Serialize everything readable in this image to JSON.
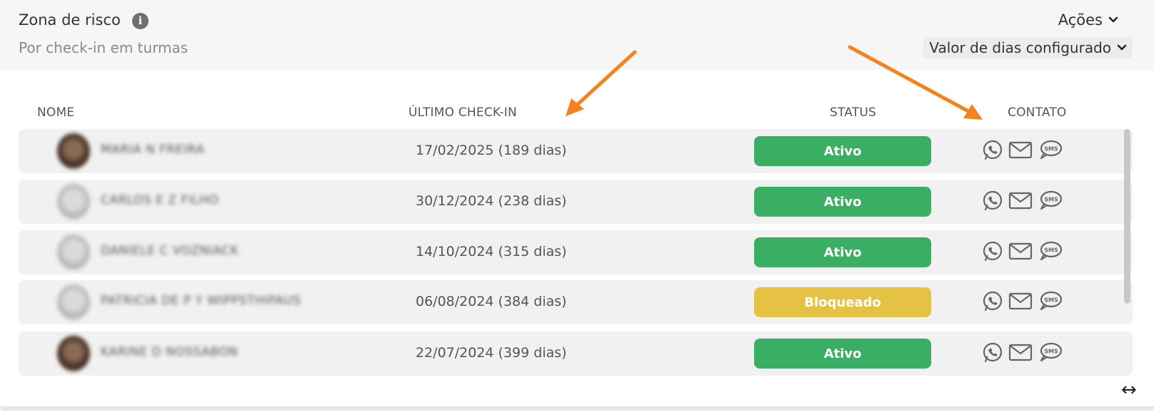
{
  "header": {
    "title": "Zona de risco",
    "subtitle": "Por check-in em turmas",
    "actions_label": "Ações",
    "days_filter_label": "Valor de dias configurado"
  },
  "table": {
    "columns": [
      "NOME",
      "ÚLTIMO CHECK-IN",
      "STATUS",
      "CONTATO"
    ],
    "rows": [
      {
        "name": "MARIA N FREIRA",
        "last_checkin": "17/02/2025 (189 dias)",
        "status": "Ativo",
        "avatar": "photo"
      },
      {
        "name": "CARLOS E Z FILHO",
        "last_checkin": "30/12/2024 (238 dias)",
        "status": "Ativo",
        "avatar": "generic"
      },
      {
        "name": "DANIELE C VOZNIACK",
        "last_checkin": "14/10/2024 (315 dias)",
        "status": "Ativo",
        "avatar": "generic"
      },
      {
        "name": "PATRICIA DE P Y WIPPSTHIPAUS",
        "last_checkin": "06/08/2024 (384 dias)",
        "status": "Bloqueado",
        "avatar": "generic"
      },
      {
        "name": "KARINE D NOSSABON",
        "last_checkin": "22/07/2024 (399 dias)",
        "status": "Ativo",
        "avatar": "photo"
      }
    ]
  },
  "colors": {
    "status_active": "#3aae63",
    "status_blocked": "#e6c244",
    "annotation_arrow": "#f5821f"
  },
  "icons": [
    "info-icon",
    "chevron-down-icon",
    "whatsapp-icon",
    "email-icon",
    "sms-icon",
    "resize-horizontal-icon"
  ]
}
